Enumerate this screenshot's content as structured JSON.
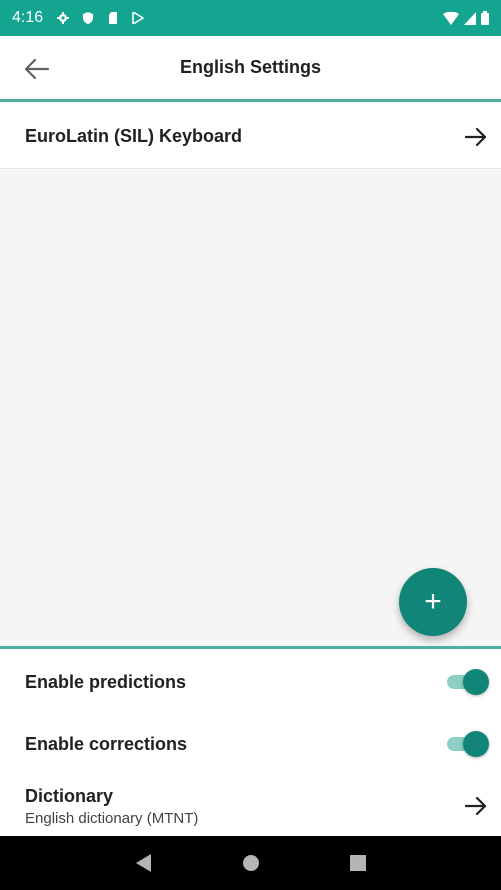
{
  "status_bar": {
    "time": "4:16",
    "icons_left": [
      "gear-icon",
      "shield-icon",
      "sd-card-icon",
      "play-store-icon"
    ],
    "icons_right": [
      "wifi-icon",
      "signal-icon",
      "battery-icon"
    ],
    "background_color": "#13a58f"
  },
  "toolbar": {
    "title": "English Settings",
    "back_icon": "arrow-back-icon"
  },
  "keyboards": [
    {
      "label": "EuroLatin (SIL) Keyboard",
      "icon": "arrow-forward-icon"
    }
  ],
  "fab": {
    "icon": "plus-icon",
    "label": "+"
  },
  "settings": {
    "predictions": {
      "label": "Enable predictions",
      "enabled": true
    },
    "corrections": {
      "label": "Enable corrections",
      "enabled": true
    },
    "dictionary": {
      "label": "Dictionary",
      "value": "English dictionary (MTNT)"
    }
  },
  "nav_bar": {
    "icons": [
      "back-triangle-icon",
      "home-circle-icon",
      "recents-square-icon"
    ]
  },
  "colors": {
    "accent": "#118577",
    "divider": "#4fae9e",
    "list_bg": "#f5f5f5"
  }
}
